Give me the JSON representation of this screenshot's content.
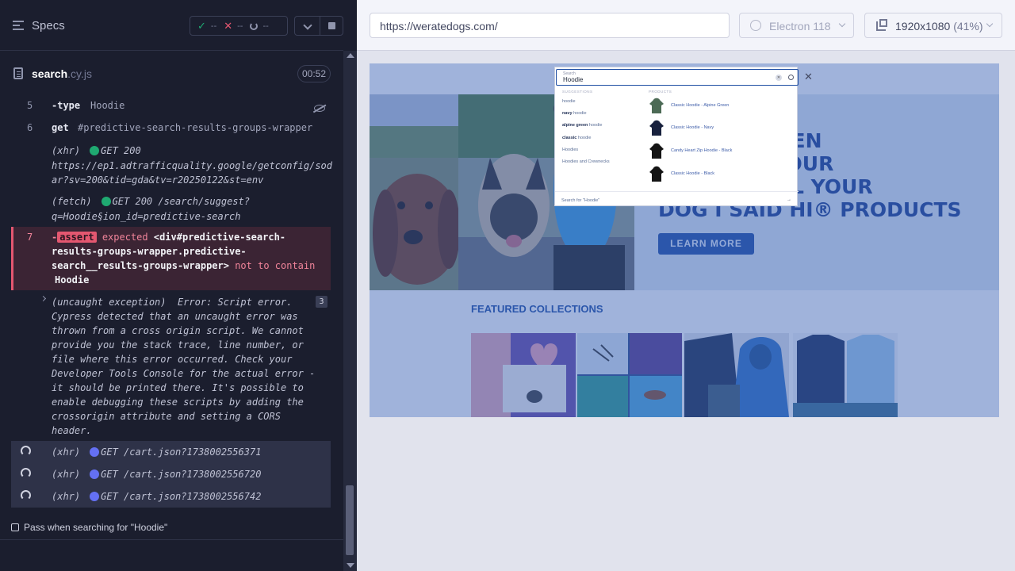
{
  "sidebar": {
    "title": "Specs",
    "stats": {
      "passed": "--",
      "failed": "--",
      "pending": "--"
    },
    "spec": {
      "name": "search",
      "ext": ".cy.js",
      "timer": "00:52"
    }
  },
  "commands": {
    "c5": {
      "num": "5",
      "name": "-type",
      "msg": "Hoodie"
    },
    "c6": {
      "num": "6",
      "name": "get",
      "msg": "#predictive-search-results-groups-wrapper"
    },
    "xhr1": {
      "type": "(xhr)",
      "status": "GET 200",
      "url_lines": [
        "https://ep1.adtrafficquality.google/getconfig/sod",
        "ar?sv=200&tid=gda&tv=r20250122&st=env"
      ]
    },
    "fetch1": {
      "type": "(fetch)",
      "status": "GET 200 /search/suggest?",
      "url_line2": "q=Hoodie§ion_id=predictive-search"
    },
    "c7": {
      "num": "7",
      "name": "assert",
      "expected": "expected",
      "selector_lines": [
        "<div#predictive-search-",
        "results-groups-wrapper.predictive-",
        "search__results-groups-wrapper>"
      ],
      "not_to_contain": "not to contain",
      "value": "Hoodie"
    },
    "exception": {
      "lines": [
        "(uncaught exception)  Error: Script error.",
        "Cypress detected that an uncaught error was",
        "thrown from a cross origin script. We cannot",
        "provide you the stack trace, line number, or",
        "file where this error occurred. Check your",
        "Developer Tools Console for the actual error -",
        "it should be printed there. It's possible to",
        "enable debugging these scripts by adding the",
        "crossorigin attribute and setting a CORS",
        "header."
      ],
      "count": "3"
    },
    "pending": [
      {
        "type": "(xhr)",
        "label": "GET /cart.json?1738002556371"
      },
      {
        "type": "(xhr)",
        "label": "GET /cart.json?1738002556720"
      },
      {
        "type": "(xhr)",
        "label": "GET /cart.json?1738002556742"
      }
    ]
  },
  "test_title": "Pass when searching for \"Hoodie\"",
  "browser": {
    "url": "https://weratedogs.com/",
    "engine": "Electron 118",
    "viewport": "1920x1080",
    "scale": "(41%)"
  },
  "aut": {
    "search": {
      "label": "Search",
      "value": "Hoodie",
      "suggestions_title": "SUGGESTIONS",
      "products_title": "PRODUCTS",
      "suggestions": [
        {
          "bold": "",
          "rest": "hoodie"
        },
        {
          "bold": "navy",
          "rest": " hoodie"
        },
        {
          "bold": "alpine green",
          "rest": " hoodie"
        },
        {
          "bold": "classic",
          "rest": " hoodie"
        },
        {
          "bold": "",
          "rest": "Hoodies"
        },
        {
          "bold": "",
          "rest": "Hoodies and Crewnecks"
        }
      ],
      "products": [
        {
          "name": "Classic Hoodie - Alpine Green",
          "color": "#4c6a55"
        },
        {
          "name": "Classic Hoodie - Navy",
          "color": "#18213d"
        },
        {
          "name": "Candy Heart Zip Hoodie - Black",
          "color": "#141414"
        },
        {
          "name": "Classic Hoodie - Black",
          "color": "#141414"
        }
      ],
      "search_for": "Search for \"Hoodie\""
    },
    "hero_lines": "        AVE BEEN\n        S TO YOUR\n        UR TELL YOUR\nDOG I SAID HI® PRODUCTS",
    "learn_more": "LEARN MORE",
    "featured": "FEATURED COLLECTIONS"
  }
}
